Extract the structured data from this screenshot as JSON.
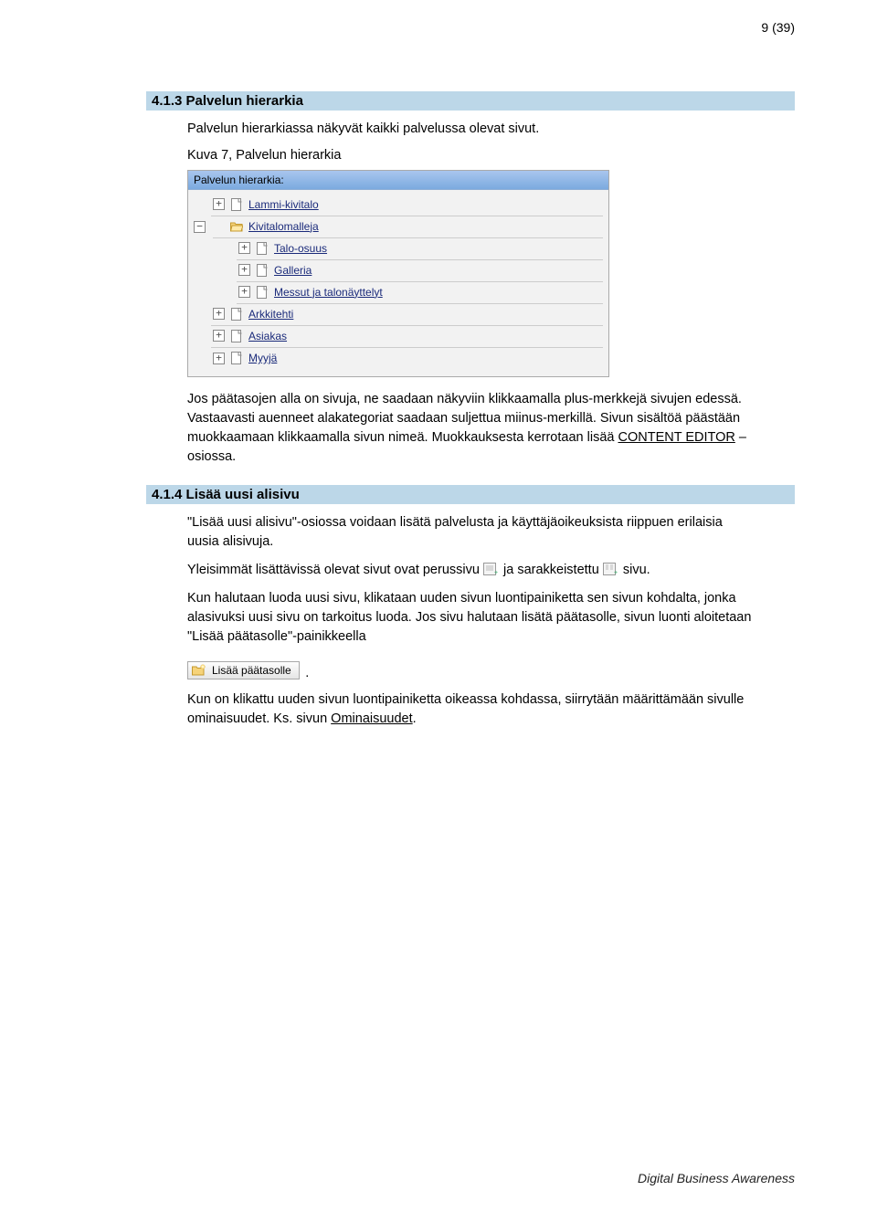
{
  "page_number": "9 (39)",
  "footer": "Digital Business Awareness",
  "section1": {
    "heading": "4.1.3 Palvelun hierarkia",
    "para1": "Palvelun hierarkiassa näkyvät kaikki palvelussa olevat sivut.",
    "caption": "Kuva 7, Palvelun hierarkia",
    "panel_header": "Palvelun hierarkia:",
    "tree": [
      {
        "label": "Lammi-kivitalo",
        "level": 0,
        "expanded": false
      },
      {
        "label": "Kivitalomalleja",
        "level": 0,
        "expanded": true,
        "folder": true
      },
      {
        "label": "Talo-osuus",
        "level": 1,
        "expanded": false
      },
      {
        "label": "Galleria",
        "level": 1,
        "expanded": false
      },
      {
        "label": "Messut ja talonäyttelyt",
        "level": 1,
        "expanded": false
      },
      {
        "label": "Arkkitehti",
        "level": 0,
        "expanded": false
      },
      {
        "label": "Asiakas",
        "level": 0,
        "expanded": false
      },
      {
        "label": "Myyjä",
        "level": 0,
        "expanded": false
      }
    ],
    "para2a": "Jos päätasojen alla on sivuja, ne saadaan näkyviin klikkaamalla plus-merkkejä sivujen edessä. Vastaavasti auenneet alakategoriat saadaan suljettua miinus-merkillä. Sivun sisältöä päästään muokkaamaan klikkaamalla sivun nimeä. Muokkauksesta kerrotaan lisää ",
    "para2_link": "CONTENT EDITOR",
    "para2b": " –osiossa."
  },
  "section2": {
    "heading": "4.1.4 Lisää uusi alisivu",
    "para1": "\"Lisää uusi alisivu\"-osiossa voidaan lisätä palvelusta ja käyttäjäoikeuksista riippuen erilaisia uusia alisivuja.",
    "para2a": "Yleisimmät lisättävissä olevat sivut ovat perussivu ",
    "para2b": " ja sarakkeistettu ",
    "para2c": " sivu.",
    "para3": "Kun halutaan luoda uusi sivu, klikataan uuden sivun luontipainiketta sen sivun kohdalta, jonka alasivuksi uusi sivu on tarkoitus luoda. Jos sivu halutaan lisätä päätasolle, sivun luonti aloitetaan \"Lisää päätasolle\"-painikkeella",
    "button_label": "Lisää päätasolle",
    "para4a": "Kun on klikattu uuden sivun luontipainiketta oikeassa kohdassa, siirrytään määrittämään sivulle ominaisuudet. Ks. sivun ",
    "para4_link": "Ominaisuudet",
    "para4b": "."
  }
}
